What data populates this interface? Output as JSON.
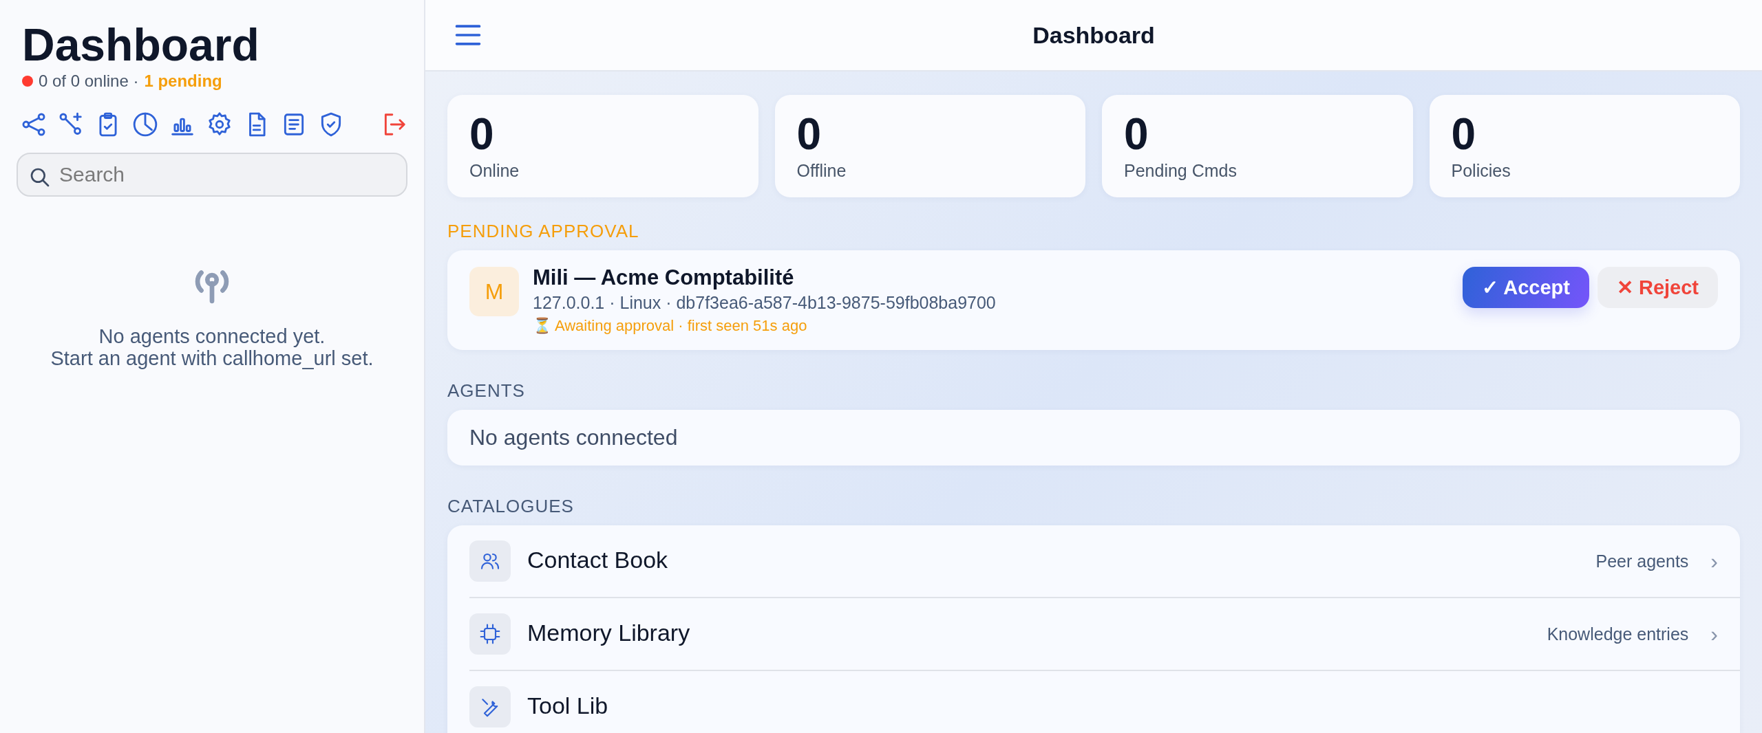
{
  "sidebar": {
    "title": "Dashboard",
    "status": {
      "online": false,
      "summary": "0 of 0 online ·",
      "pending": "1 pending"
    },
    "search": {
      "placeholder": "Search"
    },
    "empty_state": [
      "No agents connected yet.",
      "Start an agent with callhome_url set."
    ]
  },
  "header": {
    "title": "Dashboard"
  },
  "stats": [
    {
      "value": "0",
      "label": "Online"
    },
    {
      "value": "0",
      "label": "Offline"
    },
    {
      "value": "0",
      "label": "Pending Cmds"
    },
    {
      "value": "0",
      "label": "Policies"
    }
  ],
  "pending": {
    "heading": "PENDING APPROVAL",
    "items": [
      {
        "initial": "M",
        "name": "Mili — Acme Comptabilité",
        "meta": "127.0.0.1 · Linux · db7f3ea6-a587-4b13-9875-59fb08ba9700",
        "status": "⏳ Awaiting approval · first seen 51s ago",
        "actions": [
          {
            "kind": "accept",
            "label": "✓ Accept"
          },
          {
            "kind": "reject",
            "label": "✕ Reject"
          }
        ]
      }
    ]
  },
  "agents": {
    "heading": "AGENTS",
    "empty": "No agents connected"
  },
  "catalogues": {
    "heading": "CATALOGUES",
    "items": [
      {
        "kind": "contacts",
        "title": "Contact Book",
        "subtitle": "Peer agents",
        "chevron": "›"
      },
      {
        "kind": "memory",
        "title": "Memory Library",
        "subtitle": "Knowledge entries",
        "chevron": "›"
      },
      {
        "kind": "tools",
        "title": "Tool Lib"
      }
    ]
  }
}
